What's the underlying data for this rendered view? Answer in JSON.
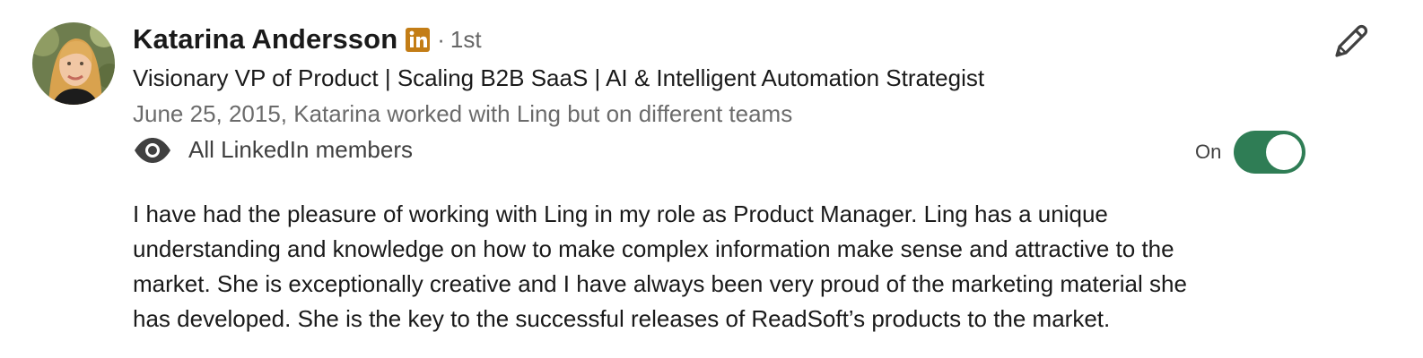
{
  "recommender": {
    "name": "Katarina Andersson",
    "badge_icon": "linkedin-badge-icon",
    "badge_color": "#c37d16",
    "degree_separator": "·",
    "degree": "1st",
    "headline": "Visionary VP of Product | Scaling B2B SaaS | AI & Intelligent Automation Strategist",
    "meta": "June 25, 2015, Katarina worked with Ling but on different teams"
  },
  "visibility": {
    "icon": "eye-icon",
    "label": "All LinkedIn members",
    "toggle_label": "On",
    "toggle_on": true,
    "toggle_color": "#2f7d55"
  },
  "edit": {
    "icon": "pencil-icon"
  },
  "recommendation": {
    "lines": [
      "I have had the pleasure of working with Ling in my role as Product Manager. Ling has a unique",
      "understanding and knowledge on how to make complex information make sense and attractive to the",
      "market. She is exceptionally creative and I have always been very proud of the marketing material she",
      "has developed. She is the key to the successful releases of ReadSoft’s products to the market."
    ]
  }
}
